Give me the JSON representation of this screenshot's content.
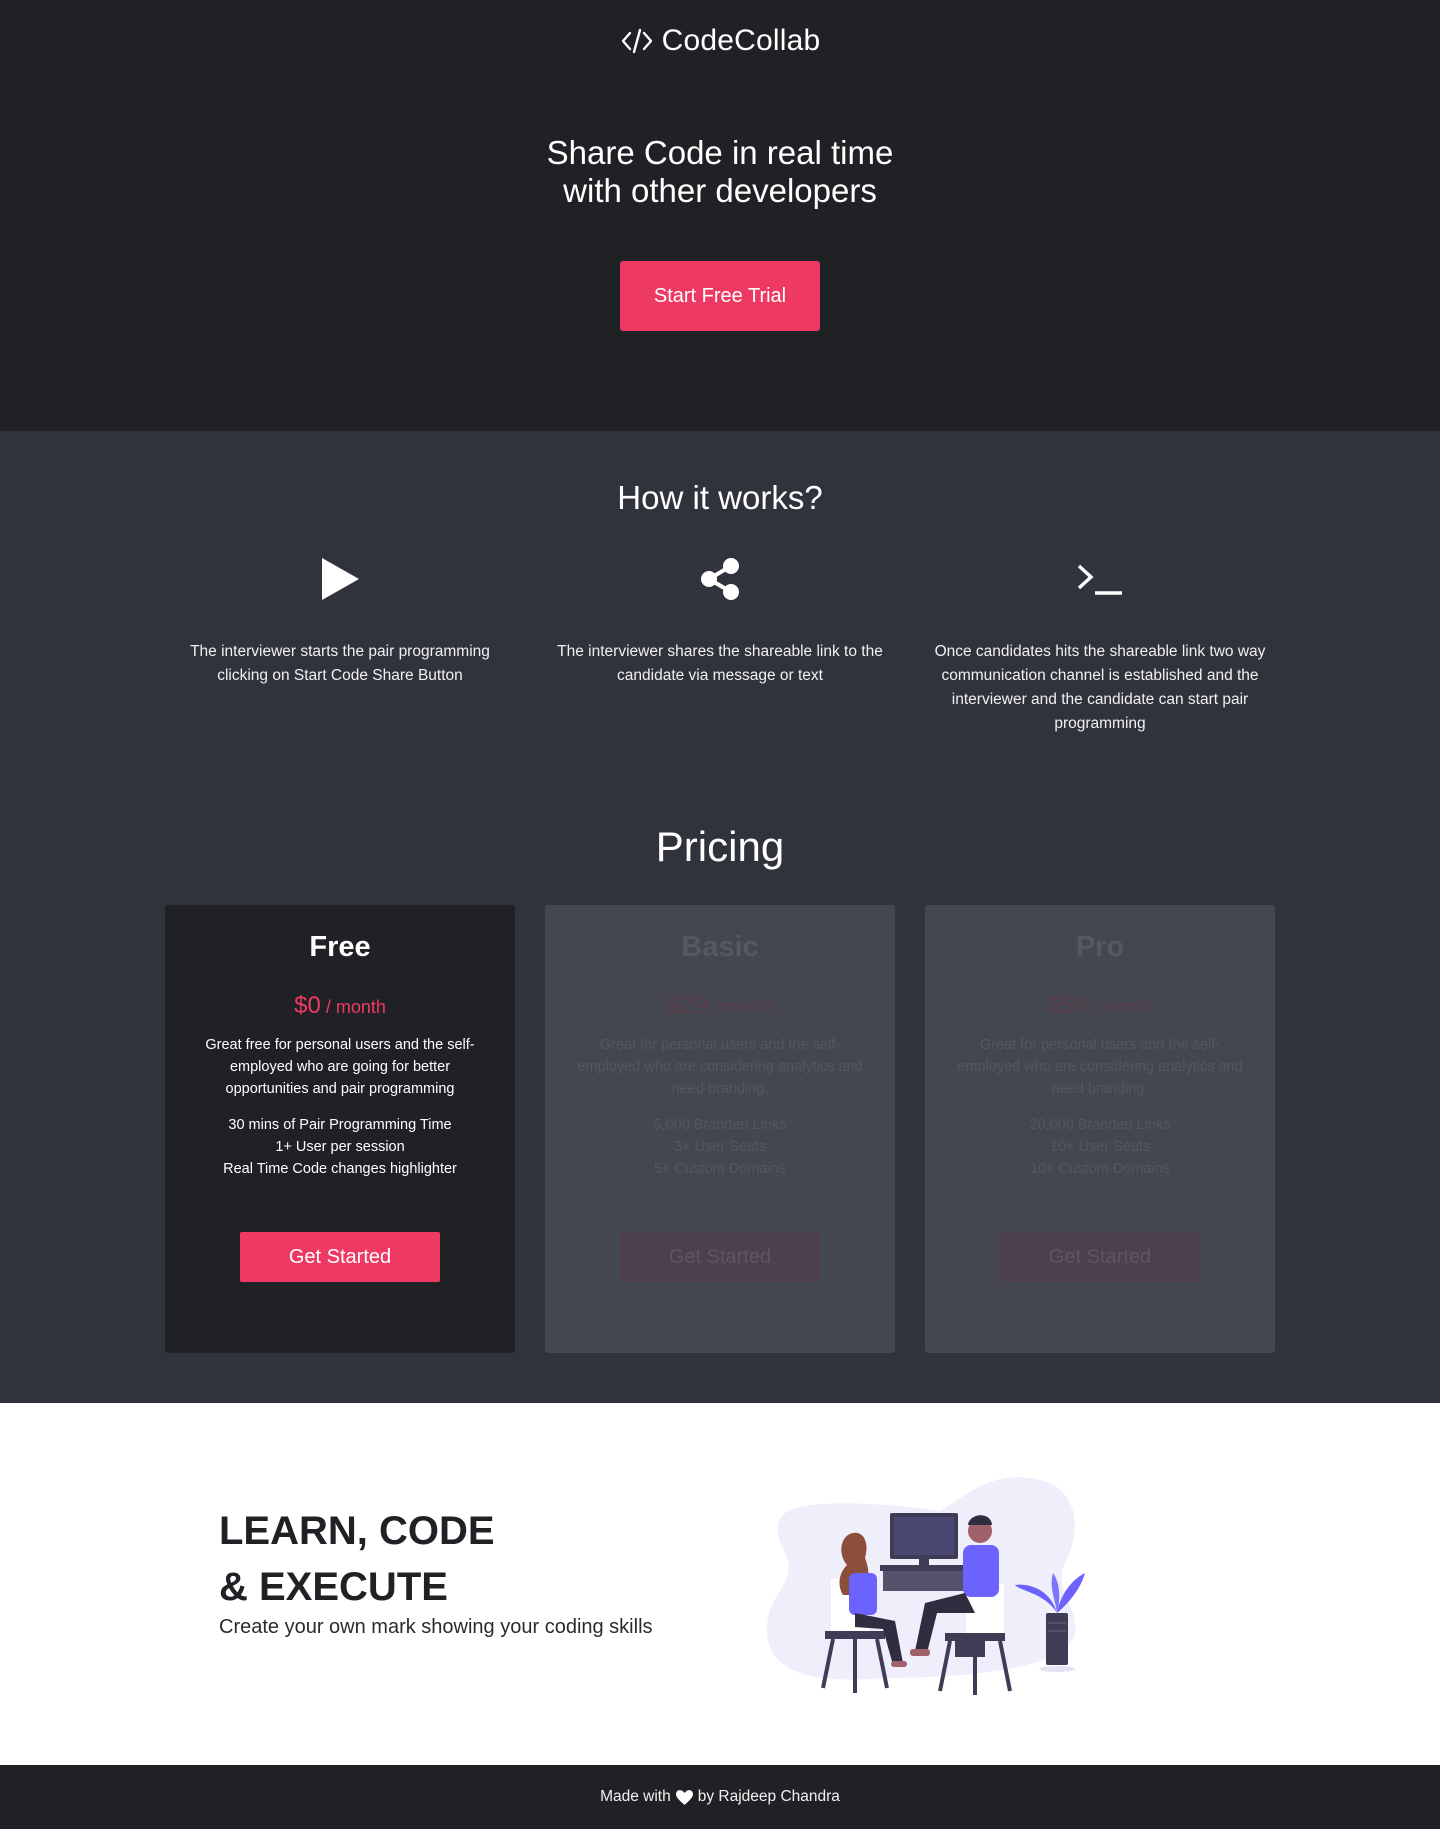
{
  "brand": {
    "name": "CodeCollab",
    "logo_icon": "code-icon"
  },
  "hero": {
    "title_line1": "Share Code in real time",
    "title_line2": "with other developers",
    "cta_label": "Start Free Trial"
  },
  "how_it_works": {
    "title": "How it works?",
    "steps": [
      {
        "icon": "play-icon",
        "text": "The interviewer starts the pair programming clicking on Start Code Share Button"
      },
      {
        "icon": "share-icon",
        "text": "The interviewer shares the shareable link to the candidate via message or text"
      },
      {
        "icon": "terminal-icon",
        "text": "Once candidates hits the shareable link two way communication channel is established and the interviewer and the candidate can start pair programming"
      }
    ]
  },
  "pricing": {
    "title": "Pricing",
    "plans": [
      {
        "name": "Free",
        "price": "$0",
        "period": " / month",
        "description": "Great free for personal users and the self-employed who are going for better opportunities and pair programming",
        "features": [
          "30 mins of Pair Programming Time",
          "1+ User per session",
          "Real Time Code changes highlighter"
        ],
        "button": "Get Started"
      },
      {
        "name": "Basic",
        "price": "$29",
        "period": " / month",
        "description": "Great for personal users and the self-employed who are considering analytics and need branding.",
        "features": [
          "5,000 Branded Links",
          "3+ User Seats",
          "5+ Custom Domains"
        ],
        "button": "Get Started"
      },
      {
        "name": "Pro",
        "price": "$59",
        "period": " / month",
        "description": "Great for personal users and the self-employed who are considering analytics and need branding.",
        "features": [
          "20,000 Branded Links",
          "10+ User Seats",
          "10+ Custom Domains"
        ],
        "button": "Get Started"
      }
    ]
  },
  "learn": {
    "heading_line1": "LEARN, CODE",
    "heading_line2": "& EXECUTE",
    "subtitle": "Create your own mark showing your coding skills"
  },
  "footer": {
    "prefix": "Made with",
    "suffix": "by Rajdeep Chandra",
    "icon": "heart-icon"
  },
  "colors": {
    "accent": "#ee3a63",
    "dark": "#1f2125",
    "section": "#30333c",
    "card_dim": "#454750",
    "illustration_purple": "#6c63ff"
  }
}
